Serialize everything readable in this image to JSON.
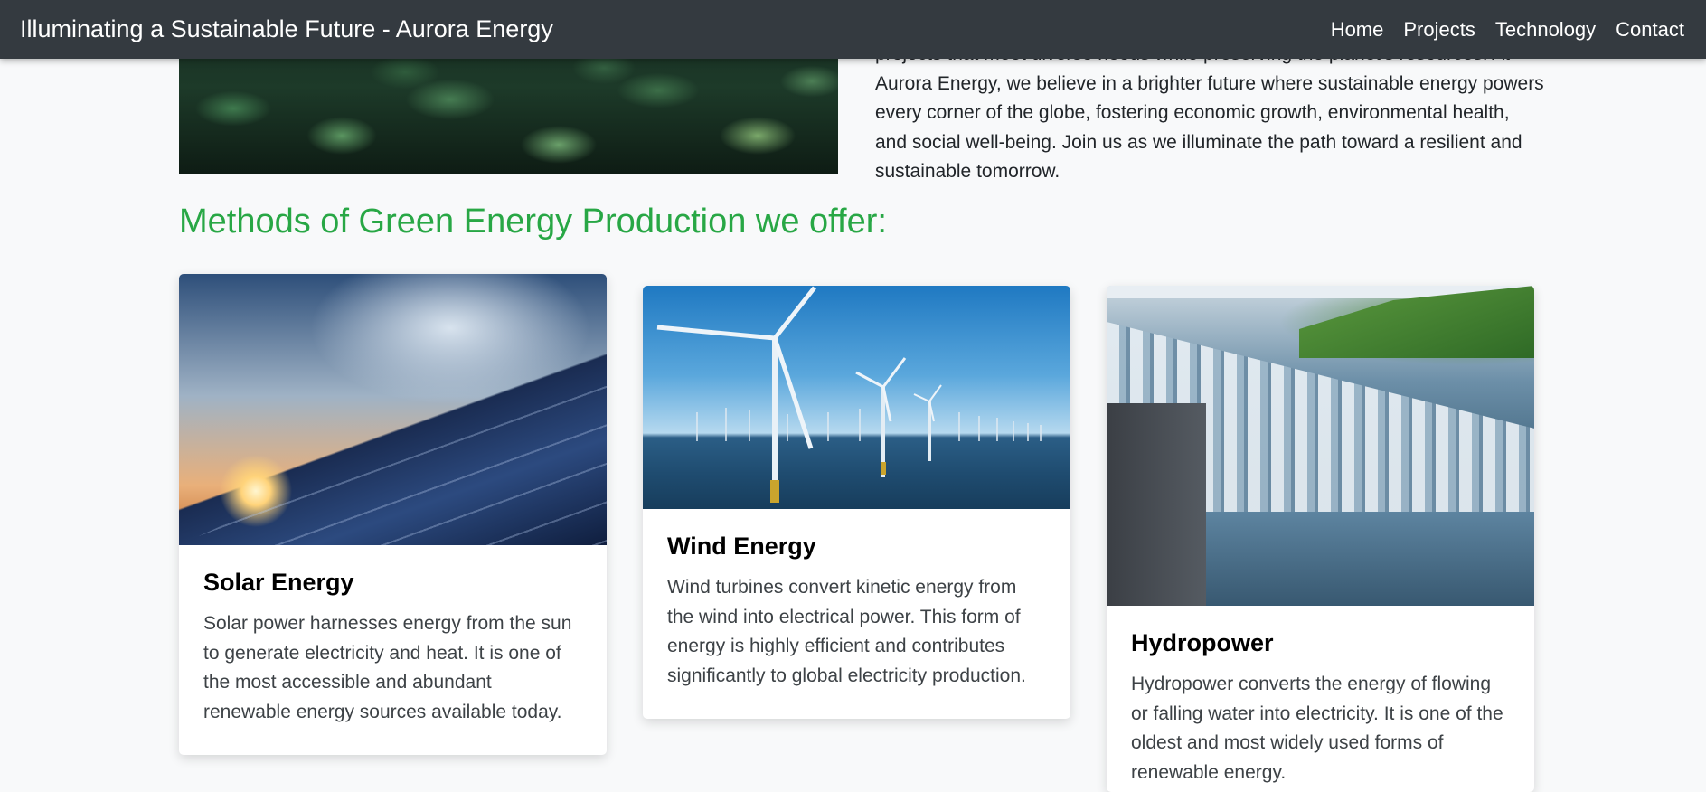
{
  "navbar": {
    "brand": "Illuminating a Sustainable Future - Aurora Energy",
    "links": [
      "Home",
      "Projects",
      "Technology",
      "Contact"
    ]
  },
  "intro": {
    "image_alt": "green leaves",
    "partial_line": "projects that meet diverse needs while preserving the planet's resources. At",
    "text": "Aurora Energy, we believe in a brighter future where sustainable energy powers every corner of the globe, fostering economic growth, environmental health, and social well-being. Join us as we illuminate the path toward a resilient and sustainable tomorrow."
  },
  "methods": {
    "title": "Methods of Green Energy Production we offer:",
    "cards": [
      {
        "title": "Solar Energy",
        "text": "Solar power harnesses energy from the sun to generate electricity and heat. It is one of the most accessible and abundant renewable energy sources available today."
      },
      {
        "title": "Wind Energy",
        "text": "Wind turbines convert kinetic energy from the wind into electrical power. This form of energy is highly efficient and contributes significantly to global electricity production."
      },
      {
        "title": "Hydropower",
        "text": "Hydropower converts the energy of flowing or falling water into electricity. It is one of the oldest and most widely used forms of renewable energy."
      }
    ]
  },
  "colors": {
    "navbar_bg": "#343a40",
    "accent_green": "#28a745",
    "page_bg": "#f8f9fa"
  }
}
